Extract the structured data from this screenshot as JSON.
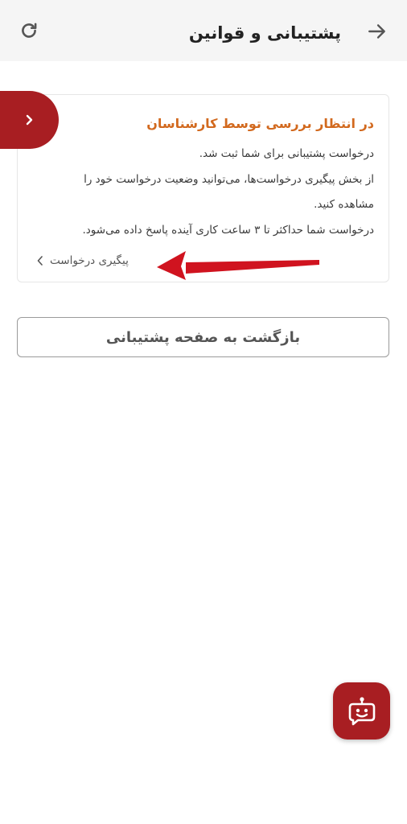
{
  "header": {
    "title": "پشتیبانی و قوانین",
    "back_icon": "arrow-right-icon",
    "refresh_icon": "refresh-icon"
  },
  "card": {
    "title": "در انتظار بررسی توسط کارشناسان",
    "lines": [
      "درخواست پشتیبانی برای شما ثبت شد.",
      "از بخش پیگیری درخواست‌ها، می‌توانید وضعیت درخواست خود را",
      "مشاهده کنید.",
      "درخواست شما حداکثر تا ۳ ساعت کاری آینده پاسخ داده می‌شود."
    ],
    "track_link": "پیگیری درخواست",
    "tab_icon": "chevron-right-icon"
  },
  "return_button": "بازگشت به صفحه پشتیبانی",
  "fab": {
    "icon": "chat-bot-icon"
  },
  "colors": {
    "brand": "#a81e22",
    "title_accent": "#d2691e",
    "annotation_arrow": "#d0131f"
  }
}
